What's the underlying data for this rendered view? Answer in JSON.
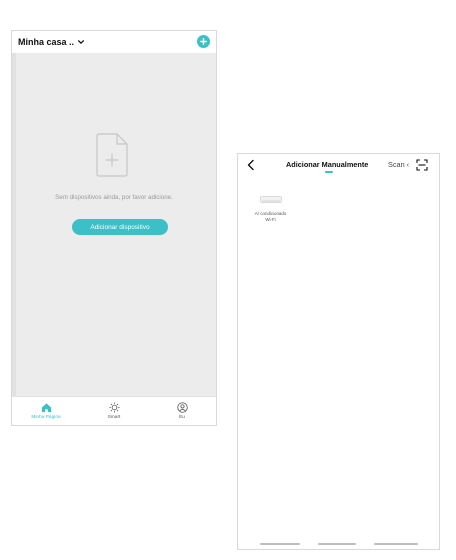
{
  "home_screen": {
    "home_name": "Minha casa ..",
    "empty_message": "Sem dispositivos ainda, por favor adicione.",
    "add_device_label": "Adicionar dispositivo",
    "tabs": [
      {
        "label": "Minha Página",
        "icon": "home-icon",
        "active": true
      },
      {
        "label": "Smart",
        "icon": "sun-icon",
        "active": false
      },
      {
        "label": "Eu",
        "icon": "user-icon",
        "active": false
      }
    ],
    "accent_color": "#3cbfc7"
  },
  "add_device_screen": {
    "tab_manual": "Adicionar Manualmente",
    "tab_scan": "Scan ‹",
    "devices": [
      {
        "name_line1": "Ar condicionado",
        "name_line2": "Wi-Fi",
        "icon": "air-conditioner-icon"
      }
    ]
  }
}
